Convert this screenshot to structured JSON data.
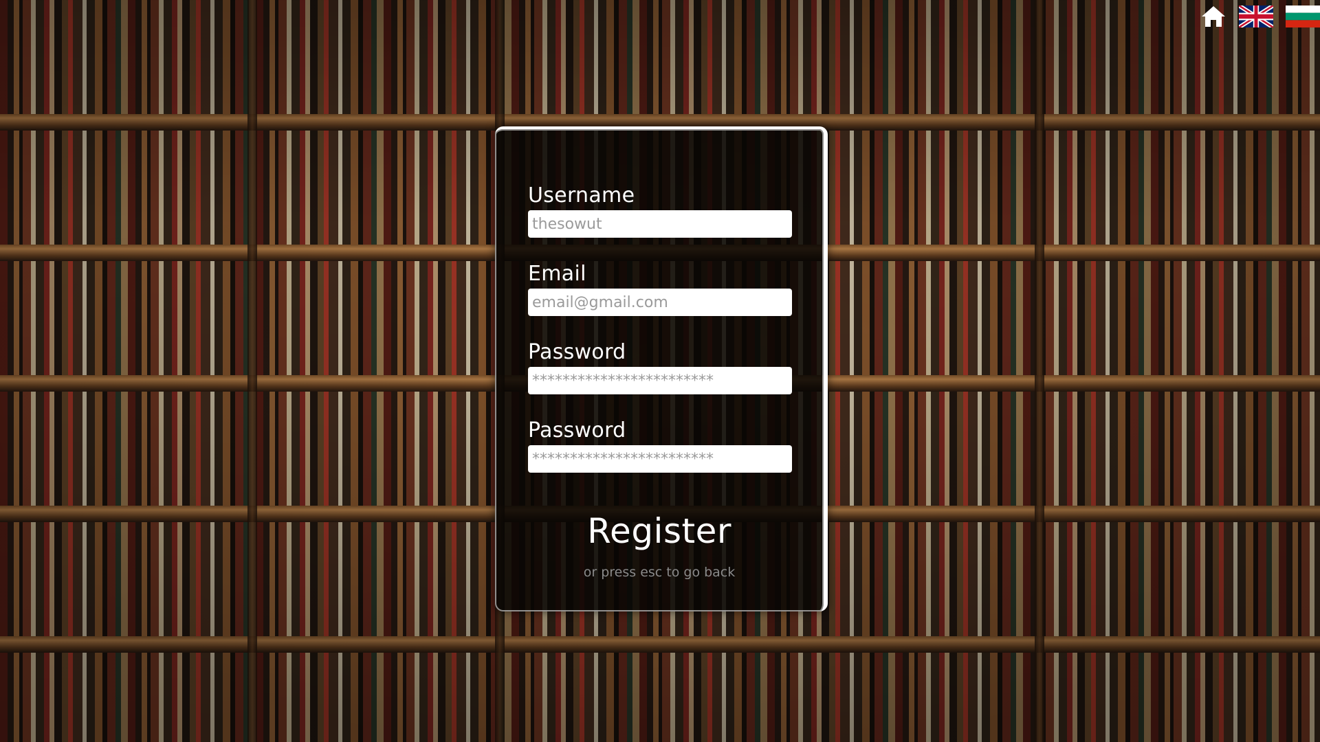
{
  "toolbar": {
    "home_icon": "home-icon",
    "languages": [
      {
        "code": "en",
        "icon": "uk-flag-icon"
      },
      {
        "code": "bg",
        "icon": "bulgaria-flag-icon"
      }
    ]
  },
  "form": {
    "username": {
      "label": "Username",
      "placeholder": "thesowut"
    },
    "email": {
      "label": "Email",
      "placeholder": "email@gmail.com"
    },
    "password": {
      "label": "Password",
      "placeholder": "************************"
    },
    "password_confirm": {
      "label": "Password",
      "placeholder": "************************"
    },
    "submit_label": "Register",
    "esc_hint": "or press esc to go back"
  },
  "colors": {
    "panel_background": "#080604",
    "label_text": "#ffffff",
    "hint_text": "#8a8a8a",
    "input_background": "#ffffff"
  }
}
